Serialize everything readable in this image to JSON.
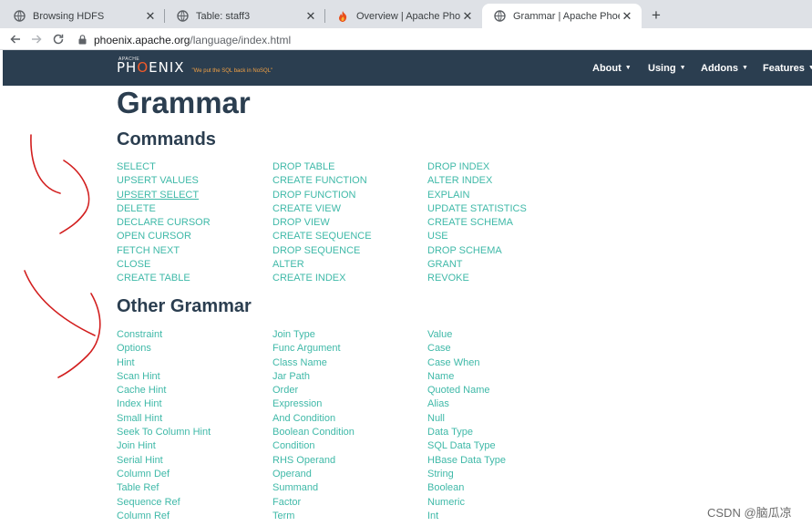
{
  "browser": {
    "tabs": [
      {
        "label": "Browsing HDFS",
        "favicon": "globe-icon"
      },
      {
        "label": "Table: staff3",
        "favicon": "globe-icon"
      },
      {
        "label": "Overview | Apache Phoenix",
        "favicon": "phoenix-flame-icon"
      },
      {
        "label": "Grammar | Apache Phoenix",
        "favicon": "globe-icon",
        "active": true
      }
    ],
    "new_tab": "+",
    "close_glyph": "✕",
    "address_host": "phoenix.apache.org",
    "address_path": "/language/index.html"
  },
  "site": {
    "logo_apache": "APACHE",
    "logo_name_pre": "PH",
    "logo_name_o": "O",
    "logo_name_post": "ENIX",
    "tagline": "\"We put the SQL back in NoSQL\"",
    "menu": [
      {
        "label": "About"
      },
      {
        "label": "Using"
      },
      {
        "label": "Addons"
      },
      {
        "label": "Features"
      }
    ],
    "caret": "▼"
  },
  "content": {
    "title": "Grammar",
    "commands_heading": "Commands",
    "commands": [
      [
        "SELECT",
        "UPSERT VALUES",
        "UPSERT SELECT",
        "DELETE",
        "DECLARE CURSOR",
        "OPEN CURSOR",
        "FETCH NEXT",
        "CLOSE",
        "CREATE TABLE"
      ],
      [
        "DROP TABLE",
        "CREATE FUNCTION",
        "DROP FUNCTION",
        "CREATE VIEW",
        "DROP VIEW",
        "CREATE SEQUENCE",
        "DROP SEQUENCE",
        "ALTER",
        "CREATE INDEX"
      ],
      [
        "DROP INDEX",
        "ALTER INDEX",
        "EXPLAIN",
        "UPDATE STATISTICS",
        "CREATE SCHEMA",
        "USE",
        "DROP SCHEMA",
        "GRANT",
        "REVOKE"
      ]
    ],
    "other_heading": "Other Grammar",
    "other": [
      [
        "Constraint",
        "Options",
        "Hint",
        "Scan Hint",
        "Cache Hint",
        "Index Hint",
        "Small Hint",
        "Seek To Column Hint",
        "Join Hint",
        "Serial Hint",
        "Column Def",
        "Table Ref",
        "Sequence Ref",
        "Column Ref"
      ],
      [
        "Join Type",
        "Func Argument",
        "Class Name",
        "Jar Path",
        "Order",
        "Expression",
        "And Condition",
        "Boolean Condition",
        "Condition",
        "RHS Operand",
        "Operand",
        "Summand",
        "Factor",
        "Term"
      ],
      [
        "Value",
        "Case",
        "Case When",
        "Name",
        "Quoted Name",
        "Alias",
        "Null",
        "Data Type",
        "SQL Data Type",
        "HBase Data Type",
        "String",
        "Boolean",
        "Numeric",
        "Int"
      ]
    ]
  },
  "watermark": "CSDN @脑瓜凉",
  "colors": {
    "link": "#3fb9a8",
    "navbar": "#2b3e50",
    "heading": "#2b3e50",
    "annotation": "#d21e1e"
  }
}
